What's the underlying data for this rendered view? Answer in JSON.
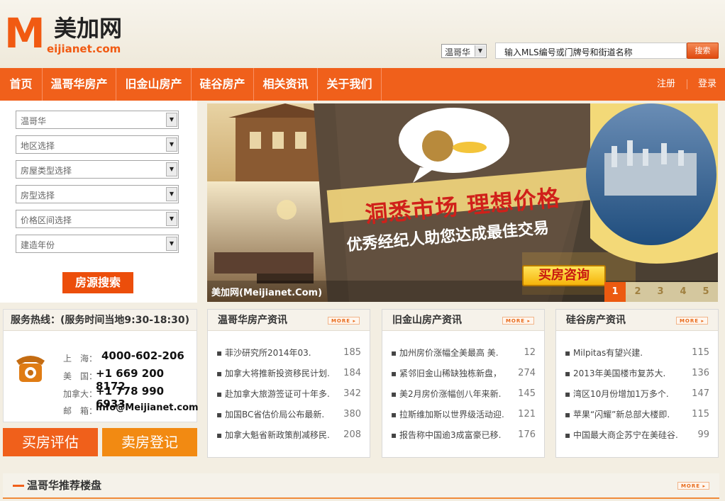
{
  "header": {
    "logo_mark": "M",
    "logo_cn": "美加网",
    "logo_en": "eijianet.com",
    "city_select": "温哥华",
    "search_placeholder": "输入MLS编号或门牌号和街道名称",
    "search_button": "搜索"
  },
  "nav": {
    "items": [
      "首页",
      "温哥华房产",
      "旧金山房产",
      "硅谷房产",
      "相关资讯",
      "关于我们"
    ],
    "register": "注册",
    "login": "登录"
  },
  "filters": {
    "selects": [
      "温哥华",
      "地区选择",
      "房屋类型选择",
      "房型选择",
      "价格区间选择",
      "建造年份"
    ],
    "search_button": "房源搜索"
  },
  "banner": {
    "headline_1": "洞悉市场  理想价格",
    "headline_2": "优秀经纪人助您达成最佳交易",
    "cta": "买房咨询",
    "caption": "美加网(Meijianet.Com)",
    "pages": [
      "1",
      "2",
      "3",
      "4",
      "5"
    ],
    "active_page": "1"
  },
  "hotline": {
    "title": "服务热线：(服务时间当地9:30-18:30)",
    "contacts": [
      {
        "label": "上　海：",
        "value": "4000-602-206"
      },
      {
        "label": "美　国：",
        "value": "+1 669 200 8172"
      },
      {
        "label": "加拿大：",
        "value": "+1 778 990 6933"
      },
      {
        "label": "邮　箱：",
        "value": "info@Meijianet.com"
      }
    ]
  },
  "actions": {
    "evaluate": "买房评估",
    "sell": "卖房登记"
  },
  "news": [
    {
      "title": "温哥华房产资讯",
      "more": "MORE ▸",
      "items": [
        {
          "text": "▪ 菲沙研究所2014年03.",
          "count": "185"
        },
        {
          "text": "▪ 加拿大将推新投资移民计划.",
          "count": "184"
        },
        {
          "text": "▪ 赴加拿大旅游签证可十年多.",
          "count": "342"
        },
        {
          "text": "▪ 加国BC省估价局公布最新.",
          "count": "380"
        },
        {
          "text": "▪ 加拿大魁省新政策削减移民.",
          "count": "208"
        }
      ]
    },
    {
      "title": "旧金山房产资讯",
      "more": "MORE ▸",
      "items": [
        {
          "text": "▪ 加州房价涨幅全美最高 美.",
          "count": "12"
        },
        {
          "text": "▪ 紧邻旧金山稀缺独栋新盘，",
          "count": "274"
        },
        {
          "text": "▪ 美2月房价涨幅创八年来新.",
          "count": "145"
        },
        {
          "text": "▪ 拉斯维加斯以世界级活动迎.",
          "count": "121"
        },
        {
          "text": "▪ 报告称中国逾3成富豪已移.",
          "count": "176"
        }
      ]
    },
    {
      "title": "硅谷房产资讯",
      "more": "MORE ▸",
      "items": [
        {
          "text": "▪ Milpitas有望兴建.",
          "count": "115"
        },
        {
          "text": "▪ 2013年美国楼市复苏大.",
          "count": "136"
        },
        {
          "text": "▪ 湾区10月份增加1万多个.",
          "count": "147"
        },
        {
          "text": "▪ 苹果“闪耀”新总部大楼即.",
          "count": "115"
        },
        {
          "text": "▪ 中国最大商企苏宁在美硅谷.",
          "count": "99"
        }
      ]
    }
  ],
  "recommend": {
    "title": "温哥华推荐楼盘",
    "more": "MORE ▸"
  },
  "colors": {
    "brand_orange": "#f0601b",
    "accent_orange": "#f28a12",
    "headline_red": "#d0201a"
  }
}
